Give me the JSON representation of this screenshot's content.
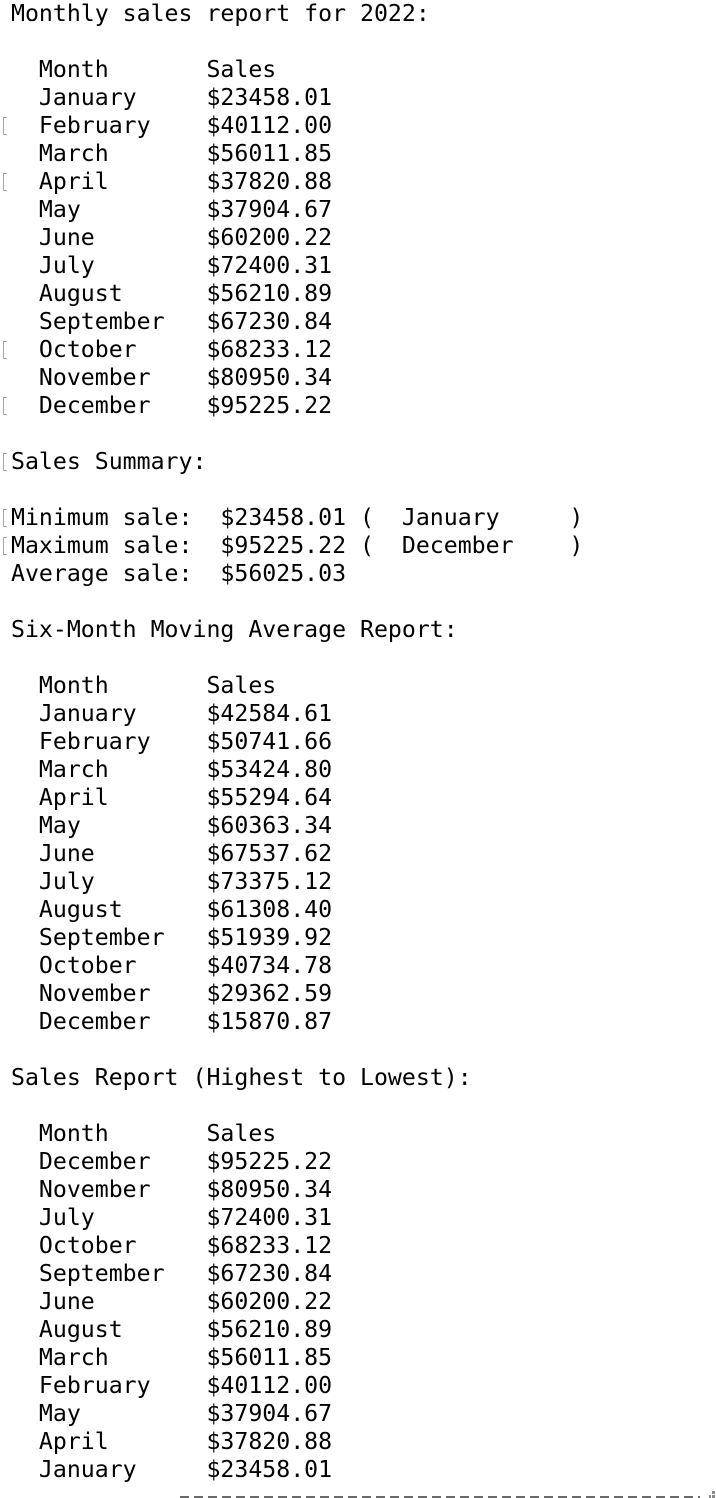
{
  "terminal": {
    "lines": [
      {
        "text": "Monthly sales report for 2022:",
        "marker": false
      },
      {
        "text": "",
        "marker": false
      },
      {
        "text": "  Month       Sales",
        "marker": false
      },
      {
        "text": "  January     $23458.01",
        "marker": false
      },
      {
        "text": "  February    $40112.00",
        "marker": true
      },
      {
        "text": "  March       $56011.85",
        "marker": false
      },
      {
        "text": "  April       $37820.88",
        "marker": true
      },
      {
        "text": "  May         $37904.67",
        "marker": false
      },
      {
        "text": "  June        $60200.22",
        "marker": false
      },
      {
        "text": "  July        $72400.31",
        "marker": false
      },
      {
        "text": "  August      $56210.89",
        "marker": false
      },
      {
        "text": "  September   $67230.84",
        "marker": false
      },
      {
        "text": "  October     $68233.12",
        "marker": true
      },
      {
        "text": "  November    $80950.34",
        "marker": false
      },
      {
        "text": "  December    $95225.22",
        "marker": true
      },
      {
        "text": "",
        "marker": false
      },
      {
        "text": "Sales Summary:",
        "marker": true
      },
      {
        "text": "",
        "marker": false
      },
      {
        "text": "Minimum sale:  $23458.01 (  January     )",
        "marker": true
      },
      {
        "text": "Maximum sale:  $95225.22 (  December    )",
        "marker": true
      },
      {
        "text": "Average sale:  $56025.03",
        "marker": false
      },
      {
        "text": "",
        "marker": false
      },
      {
        "text": "Six-Month Moving Average Report:",
        "marker": false
      },
      {
        "text": "",
        "marker": false
      },
      {
        "text": "  Month       Sales",
        "marker": false
      },
      {
        "text": "  January     $42584.61",
        "marker": false
      },
      {
        "text": "  February    $50741.66",
        "marker": false
      },
      {
        "text": "  March       $53424.80",
        "marker": false
      },
      {
        "text": "  April       $55294.64",
        "marker": false
      },
      {
        "text": "  May         $60363.34",
        "marker": false
      },
      {
        "text": "  June        $67537.62",
        "marker": false
      },
      {
        "text": "  July        $73375.12",
        "marker": false
      },
      {
        "text": "  August      $61308.40",
        "marker": false
      },
      {
        "text": "  September   $51939.92",
        "marker": false
      },
      {
        "text": "  October     $40734.78",
        "marker": false
      },
      {
        "text": "  November    $29362.59",
        "marker": false
      },
      {
        "text": "  December    $15870.87",
        "marker": false
      },
      {
        "text": "",
        "marker": false
      },
      {
        "text": "Sales Report (Highest to Lowest):",
        "marker": false
      },
      {
        "text": "",
        "marker": false
      },
      {
        "text": "  Month       Sales",
        "marker": false
      },
      {
        "text": "  December    $95225.22",
        "marker": false
      },
      {
        "text": "  November    $80950.34",
        "marker": false
      },
      {
        "text": "  July        $72400.31",
        "marker": false
      },
      {
        "text": "  October     $68233.12",
        "marker": false
      },
      {
        "text": "  September   $67230.84",
        "marker": false
      },
      {
        "text": "  June        $60200.22",
        "marker": false
      },
      {
        "text": "  August      $56210.89",
        "marker": false
      },
      {
        "text": "  March       $56011.85",
        "marker": false
      },
      {
        "text": "  February    $40112.00",
        "marker": false
      },
      {
        "text": "  May         $37904.67",
        "marker": false
      },
      {
        "text": "  April       $37820.88",
        "marker": false
      },
      {
        "text": "  January     $23458.01",
        "marker": false
      }
    ]
  },
  "colors": {
    "background": "#ffffff",
    "text": "#000000",
    "marker": "#a6a6a6"
  }
}
